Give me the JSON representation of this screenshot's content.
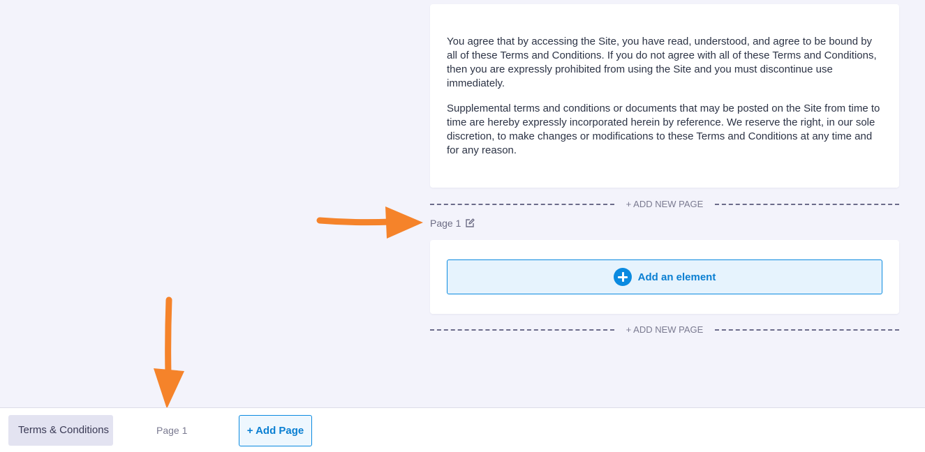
{
  "content": {
    "paragraphs": [
      "You agree that by accessing the Site, you have read, understood, and agree to be bound by all of these Terms and Conditions. If you do not agree with all of these Terms and Conditions, then you are expressly prohibited from using the Site and you must discontinue use immediately.",
      "Supplemental terms and conditions or documents that may be posted on the Site from time to time are hereby expressly incorporated herein by reference. We reserve the right, in our sole discretion, to make changes or modifications to these Terms and Conditions at any time and for any reason."
    ]
  },
  "dividers": {
    "add_new_page_label": "+ ADD NEW PAGE"
  },
  "page_section": {
    "label": "Page 1",
    "edit_icon": "edit-icon",
    "add_element_label": "Add an element",
    "add_element_icon": "plus-circle-icon"
  },
  "bottom_bar": {
    "tabs": [
      {
        "label": "Terms & Conditions"
      },
      {
        "label": "Page 1"
      }
    ],
    "add_page_label": "+ Add Page"
  },
  "colors": {
    "accent": "#0a8ae0",
    "background": "#f3f3fb",
    "annotation_arrow": "#f5832a"
  }
}
